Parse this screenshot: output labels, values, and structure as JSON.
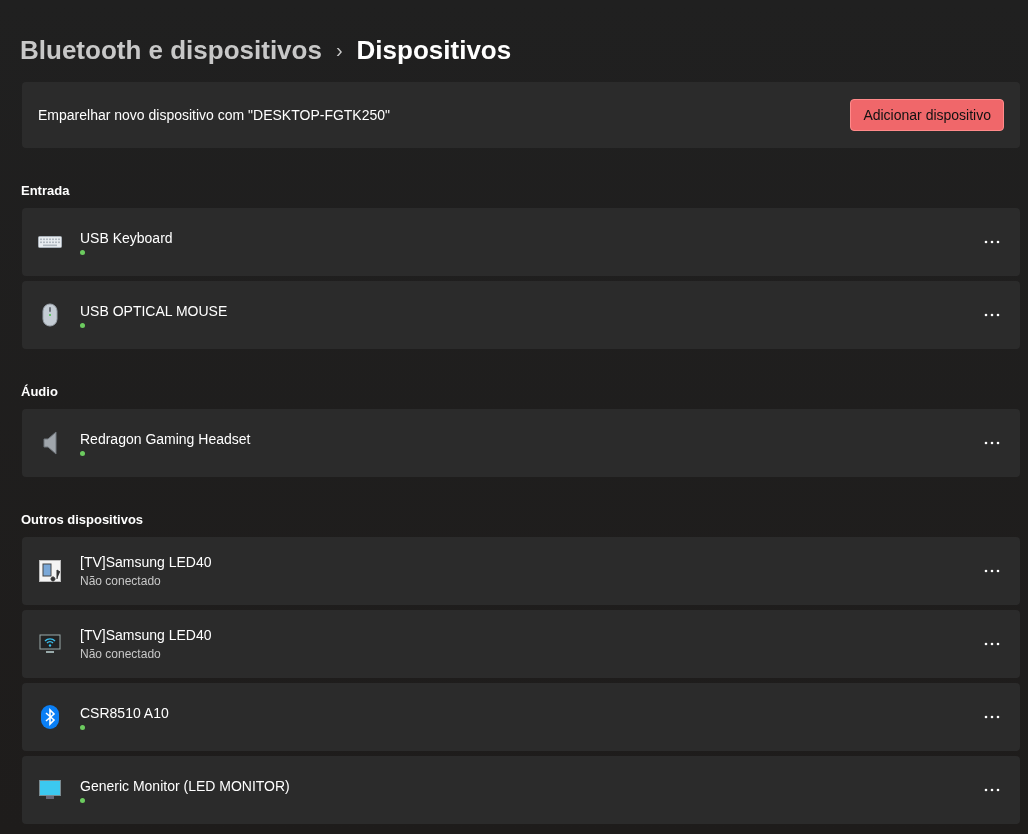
{
  "breadcrumb": {
    "parent": "Bluetooth e dispositivos",
    "separator": "›",
    "current": "Dispositivos"
  },
  "pair_card": {
    "text": "Emparelhar novo dispositivo com \"DESKTOP-FGTK250\"",
    "button": "Adicionar dispositivo"
  },
  "sections": [
    {
      "title": "Entrada",
      "devices": [
        {
          "kind": "keyboard",
          "name": "USB Keyboard",
          "connected": true
        },
        {
          "kind": "mouse",
          "name": "USB OPTICAL MOUSE",
          "connected": true
        }
      ]
    },
    {
      "title": "Áudio",
      "devices": [
        {
          "kind": "speaker",
          "name": "Redragon Gaming Headset",
          "connected": true
        }
      ]
    },
    {
      "title": "Outros dispositivos",
      "devices": [
        {
          "kind": "media",
          "name": "[TV]Samsung LED40",
          "connected": false,
          "status": "Não conectado"
        },
        {
          "kind": "wireless-display",
          "name": "[TV]Samsung LED40",
          "connected": false,
          "status": "Não conectado"
        },
        {
          "kind": "bluetooth",
          "name": "CSR8510 A10",
          "connected": true
        },
        {
          "kind": "monitor",
          "name": "Generic Monitor (LED MONITOR)",
          "connected": true
        }
      ]
    }
  ]
}
